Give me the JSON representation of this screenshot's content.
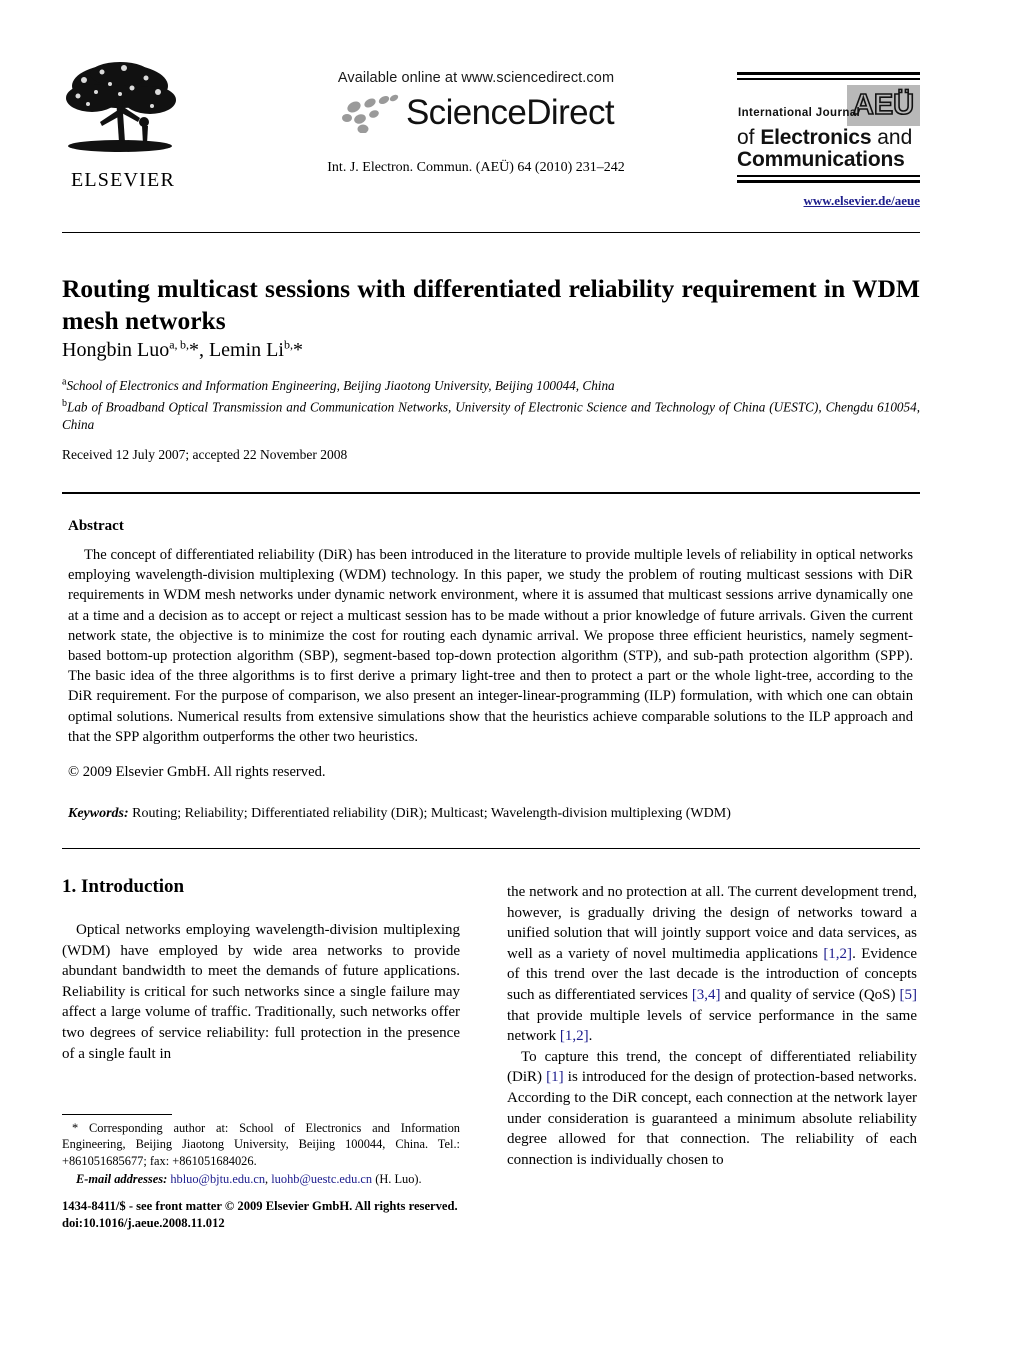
{
  "masthead": {
    "elsevier_wordmark": "ELSEVIER",
    "available_online": "Available online at www.sciencedirect.com",
    "sciencedirect_wordmark": "ScienceDirect",
    "journal_reference": "Int. J. Electron. Commun. (AEÜ) 64 (2010) 231–242",
    "aeu": {
      "badge": "AEÜ",
      "intl_journal": "International Journal",
      "line2_bold": "Electronics",
      "line2_prefix": "of ",
      "line2_suffix": " and",
      "line3": "Communications",
      "url": "www.elsevier.de/aeue"
    }
  },
  "article": {
    "title": "Routing multicast sessions with differentiated reliability requirement in WDM mesh networks",
    "authors_html": "Hongbin Luo<sup>a, b,</sup>*, Lemin Li<sup>b,</sup>*",
    "affiliation_a": "School of Electronics and Information Engineering, Beijing Jiaotong University, Beijing 100044, China",
    "affiliation_b": "Lab of Broadband Optical Transmission and Communication Networks, University of Electronic Science and Technology of China (UESTC), Chengdu 610054, China",
    "history": "Received 12 July 2007; accepted 22 November 2008"
  },
  "abstract": {
    "heading": "Abstract",
    "text": "The concept of differentiated reliability (DiR) has been introduced in the literature to provide multiple levels of reliability in optical networks employing wavelength-division multiplexing (WDM) technology. In this paper, we study the problem of routing multicast sessions with DiR requirements in WDM mesh networks under dynamic network environment, where it is assumed that multicast sessions arrive dynamically one at a time and a decision as to accept or reject a multicast session has to be made without a prior knowledge of future arrivals. Given the current network state, the objective is to minimize the cost for routing each dynamic arrival. We propose three efficient heuristics, namely segment-based bottom-up protection algorithm (SBP), segment-based top-down protection algorithm (STP), and sub-path protection algorithm (SPP). The basic idea of the three algorithms is to first derive a primary light-tree and then to protect a part or the whole light-tree, according to the DiR requirement. For the purpose of comparison, we also present an integer-linear-programming (ILP) formulation, with which one can obtain optimal solutions. Numerical results from extensive simulations show that the heuristics achieve comparable solutions to the ILP approach and that the SPP algorithm outperforms the other two heuristics.",
    "copyright": "© 2009 Elsevier GmbH. All rights reserved.",
    "keywords_label": "Keywords:",
    "keywords_text": "Routing; Reliability; Differentiated reliability (DiR); Multicast; Wavelength-division multiplexing (WDM)"
  },
  "introduction": {
    "heading": "1. Introduction",
    "left_paragraph_1": "Optical networks employing wavelength-division multiplexing (WDM) have employed by wide area networks to provide abundant bandwidth to meet the demands of future applications. Reliability is critical for such networks since a single failure may affect a large volume of traffic. Traditionally, such networks offer two degrees of service reliability: full protection in the presence of a single fault in",
    "right_paragraph_1_a": "the network and no protection at all. The current development trend, however, is gradually driving the design of networks toward a unified solution that will jointly support voice and data services, as well as a variety of novel multimedia applications ",
    "right_ref_1": "[1,2]",
    "right_paragraph_1_b": ". Evidence of this trend over the last decade is the introduction of concepts such as differentiated services ",
    "right_ref_2": "[3,4]",
    "right_paragraph_1_c": " and quality of service (QoS) ",
    "right_ref_3": "[5]",
    "right_paragraph_1_d": " that provide multiple levels of service performance in the same network ",
    "right_ref_4": "[1,2]",
    "right_paragraph_1_e": ".",
    "right_paragraph_2_a": "To capture this trend, the concept of differentiated reliability (DiR) ",
    "right_ref_5": "[1]",
    "right_paragraph_2_b": " is introduced for the design of protection-based networks. According to the DiR concept, each connection at the network layer under consideration is guaranteed a minimum absolute reliability degree allowed for that connection. The reliability of each connection is individually chosen to"
  },
  "footnotes": {
    "corresponding_author": "* Corresponding author at: School of Electronics and Information Engineering, Beijing Jiaotong University, Beijing 100044, China. Tel.: +861051685677; fax: +861051684026.",
    "email_label": "E-mail addresses:",
    "email_1": "hbluo@bjtu.edu.cn",
    "email_separator": ", ",
    "email_2": "luohb@uestc.edu.cn",
    "email_suffix": " (H. Luo)."
  },
  "imprint": {
    "issn_line": "1434-8411/$ - see front matter © 2009 Elsevier GmbH. All rights reserved.",
    "doi_line": "doi:10.1016/j.aeue.2008.11.012"
  },
  "colors": {
    "link_blue": "#1a1a8c",
    "badge_gray": "#b8b8b8"
  }
}
